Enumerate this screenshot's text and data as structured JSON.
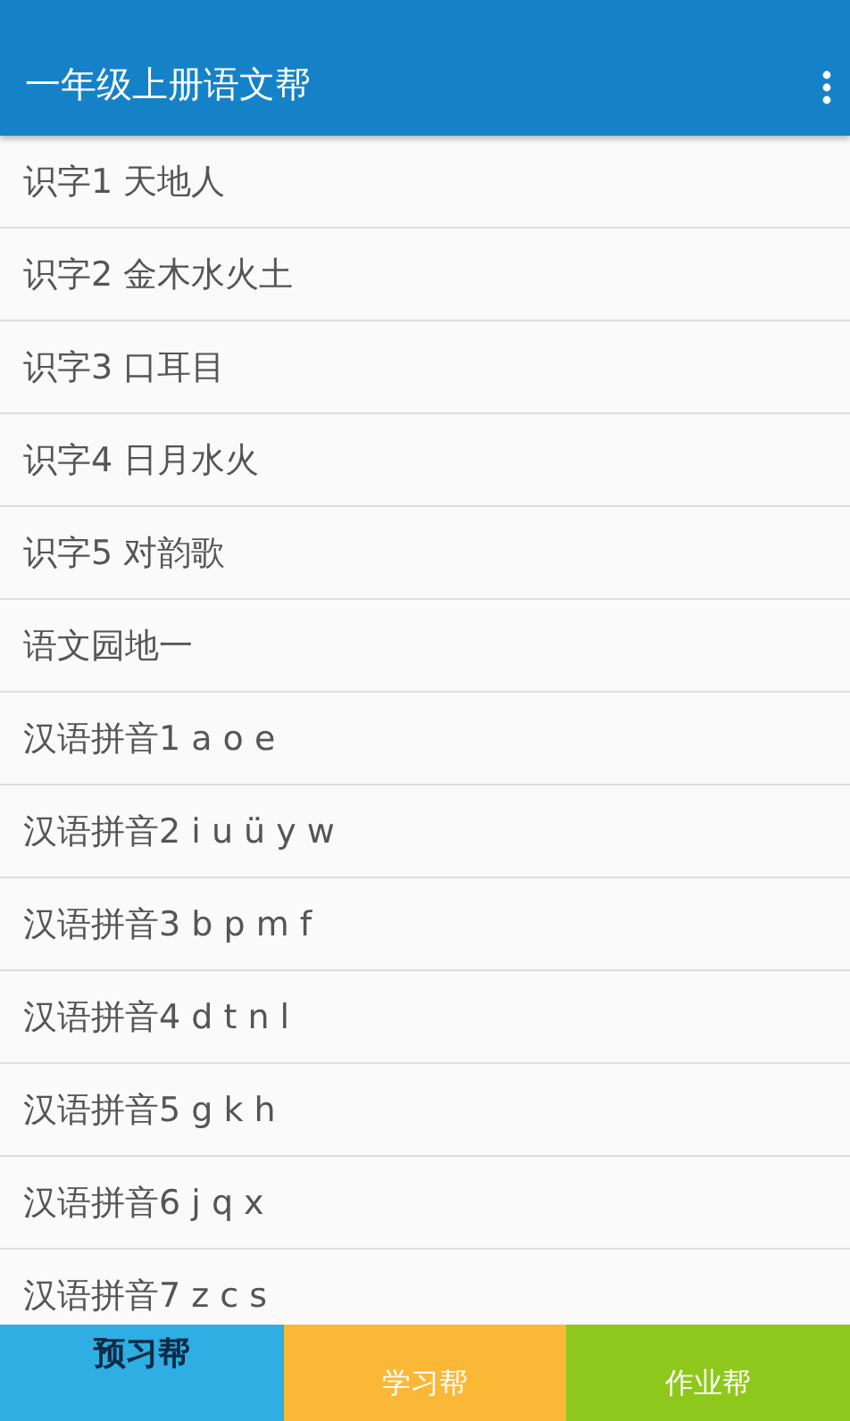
{
  "app_bar": {
    "title": "一年级上册语文帮"
  },
  "lessons": [
    {
      "title": "识字1 天地人"
    },
    {
      "title": "识字2 金木水火土"
    },
    {
      "title": "识字3 口耳目"
    },
    {
      "title": "识字4 日月水火"
    },
    {
      "title": "识字5 对韵歌"
    },
    {
      "title": "语文园地一"
    },
    {
      "title": "汉语拼音1 a o e"
    },
    {
      "title": "汉语拼音2 i u ü y w"
    },
    {
      "title": "汉语拼音3 b p m f"
    },
    {
      "title": "汉语拼音4 d t n l"
    },
    {
      "title": "汉语拼音5 g k h"
    },
    {
      "title": "汉语拼音6 j q x"
    },
    {
      "title": "汉语拼音7 z c s"
    }
  ],
  "bottom_tabs": [
    {
      "label": "预习帮",
      "selected": true,
      "color": "#2eaee2"
    },
    {
      "label": "学习帮",
      "selected": false,
      "color": "#fbb836"
    },
    {
      "label": "作业帮",
      "selected": false,
      "color": "#8fc81c"
    }
  ]
}
